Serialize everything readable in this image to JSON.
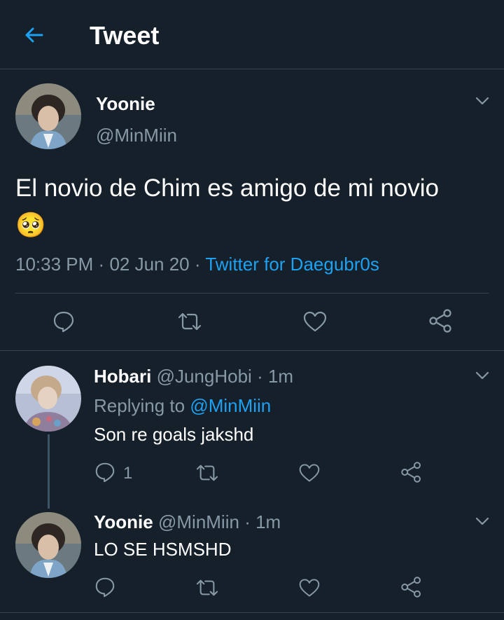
{
  "header": {
    "title": "Tweet"
  },
  "main_tweet": {
    "display_name": "Yoonie",
    "handle": "@MinMiin",
    "text": "El novio de Chim es amigo de mi novio",
    "emoji": "🥺",
    "time": "10:33 PM",
    "separator": "·",
    "date": "02 Jun 20",
    "source": "Twitter for Daegubr0s"
  },
  "replies": [
    {
      "display_name": "Hobari",
      "handle": "@JungHobi",
      "dot": "·",
      "time": "1m",
      "replying_label": "Replying to",
      "replying_handle": "@MinMiin",
      "text": "Son re goals jakshd",
      "reply_count": "1"
    },
    {
      "display_name": "Yoonie",
      "handle": "@MinMiin",
      "dot": "·",
      "time": "1m",
      "text": "LO SE HSMSHD"
    }
  ],
  "colors": {
    "background": "#15202b",
    "accent": "#1da1f2",
    "muted": "#8899a6",
    "divider": "#38444d"
  }
}
